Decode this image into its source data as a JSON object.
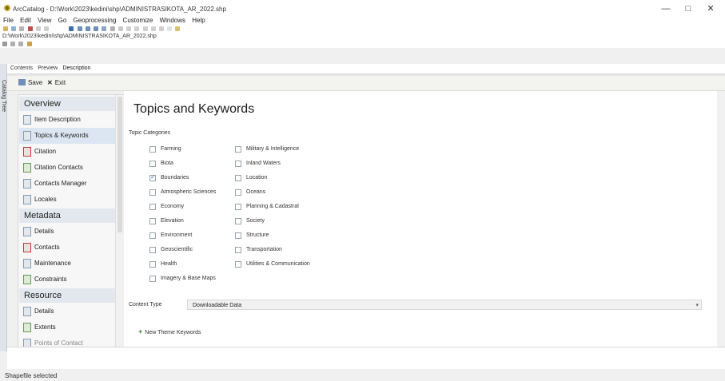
{
  "window": {
    "title": "ArcCatalog - D:\\Work\\2023\\kedini\\shp\\ADMINISTRASIKOTA_AR_2022.shp",
    "minimize": "—",
    "maximize": "□",
    "close": "✕"
  },
  "menu": [
    "File",
    "Edit",
    "View",
    "Go",
    "Geoprocessing",
    "Customize",
    "Windows",
    "Help"
  ],
  "location": "D:\\Work\\2023\\kedini\\shp\\ADMINISTRASIKOTA_AR_2022.shp",
  "side_strip": "Catalog Tree",
  "tabs": [
    "Contents",
    "Preview",
    "Description"
  ],
  "actions": {
    "save": "Save",
    "exit": "Exit"
  },
  "nav": {
    "overview_head": "Overview",
    "overview": [
      "Item Description",
      "Topics & Keywords",
      "Citation",
      "Citation Contacts",
      "Contacts Manager",
      "Locales"
    ],
    "metadata_head": "Metadata",
    "metadata": [
      "Details",
      "Contacts",
      "Maintenance",
      "Constraints"
    ],
    "resource_head": "Resource",
    "resource": [
      "Details",
      "Extents",
      "Points of Contact"
    ]
  },
  "content": {
    "heading": "Topics and Keywords",
    "topic_categories_label": "Topic Categories",
    "categories_left": [
      {
        "label": "Farming",
        "checked": false
      },
      {
        "label": "Biota",
        "checked": false
      },
      {
        "label": "Boundaries",
        "checked": true
      },
      {
        "label": "Atmospheric Sciences",
        "checked": false
      },
      {
        "label": "Economy",
        "checked": false
      },
      {
        "label": "Elevation",
        "checked": false
      },
      {
        "label": "Environment",
        "checked": false
      },
      {
        "label": "Geoscientific",
        "checked": false
      },
      {
        "label": "Health",
        "checked": false
      },
      {
        "label": "Imagery & Base Maps",
        "checked": false
      }
    ],
    "categories_right": [
      {
        "label": "Military & Intelligence",
        "checked": false
      },
      {
        "label": "Inland Waters",
        "checked": false
      },
      {
        "label": "Location",
        "checked": false
      },
      {
        "label": "Oceans",
        "checked": false
      },
      {
        "label": "Planning & Cadastral",
        "checked": false
      },
      {
        "label": "Society",
        "checked": false
      },
      {
        "label": "Structure",
        "checked": false
      },
      {
        "label": "Transportation",
        "checked": false
      },
      {
        "label": "Utilities & Communication",
        "checked": false
      }
    ],
    "content_type_label": "Content Type",
    "content_type_value": "Downloadable Data",
    "new_theme_keywords": "New Theme Keywords"
  },
  "status": "Shapefile selected"
}
